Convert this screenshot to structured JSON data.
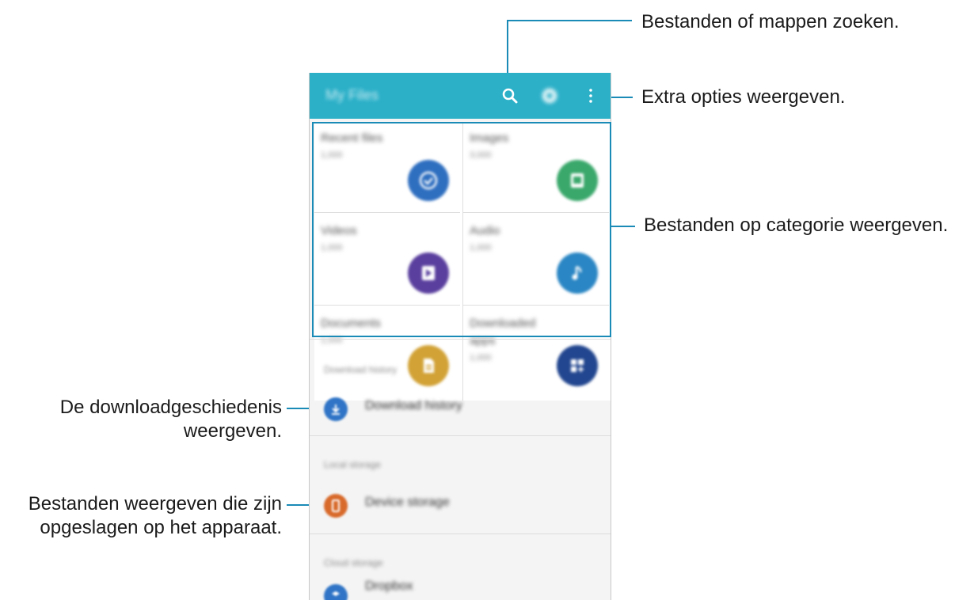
{
  "callouts": {
    "search": "Bestanden of mappen zoeken.",
    "options": "Extra opties weergeven.",
    "categories": "Bestanden op categorie weergeven.",
    "download_line1": "De downloadgeschiedenis",
    "download_line2": "weergeven.",
    "device_line1": "Bestanden weergeven die zijn",
    "device_line2": "opgeslagen op het apparaat."
  },
  "app": {
    "title": "My Files",
    "accent_color": "#2bb0c8",
    "toolbar_icons": [
      "search-icon",
      "storage-usage-icon",
      "more-options-icon"
    ]
  },
  "categories": [
    {
      "label": "Recent files",
      "count": "1,000",
      "icon": "clock-icon",
      "color": "#2f6fc0"
    },
    {
      "label": "Images",
      "count": "3,000",
      "icon": "image-icon",
      "color": "#3aa86b"
    },
    {
      "label": "Videos",
      "count": "1,000",
      "icon": "video-icon",
      "color": "#5a3f9e"
    },
    {
      "label": "Audio",
      "count": "1,000",
      "icon": "music-icon",
      "color": "#2a86c4"
    },
    {
      "label": "Documents",
      "count": "1,000",
      "icon": "document-icon",
      "color": "#d2a236"
    },
    {
      "label": "Downloaded apps",
      "count": "1,000",
      "icon": "apps-icon",
      "color": "#22468f"
    }
  ],
  "sections": [
    {
      "header": "Download history",
      "item": "Download history",
      "icon": "download-icon",
      "color": "#2f74c6"
    },
    {
      "header": "Local storage",
      "item": "Device storage",
      "icon": "device-icon",
      "color": "#d86a2b"
    },
    {
      "header": "Cloud storage",
      "item": "Dropbox",
      "icon": "dropbox-icon",
      "color": "#2f74c6"
    }
  ]
}
